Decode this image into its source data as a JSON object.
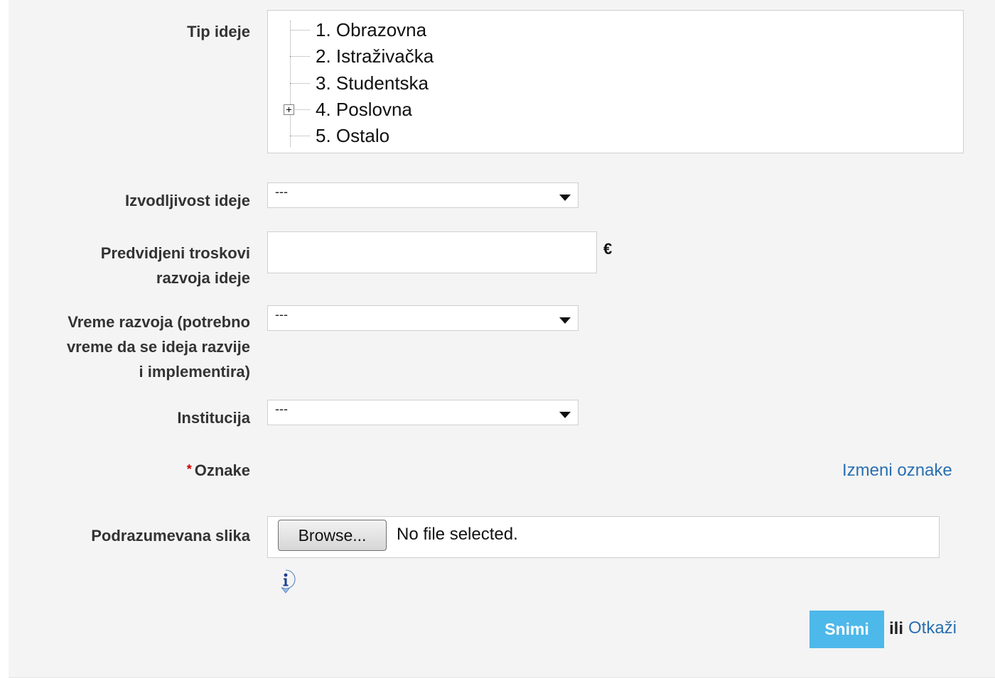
{
  "form": {
    "idea_type": {
      "label": "Tip ideje",
      "items": [
        {
          "label": "1. Obrazovna",
          "expandable": false
        },
        {
          "label": "2. Istraživačka",
          "expandable": false
        },
        {
          "label": "3. Studentska",
          "expandable": false
        },
        {
          "label": "4. Poslovna",
          "expandable": true
        },
        {
          "label": "5. Ostalo",
          "expandable": false
        }
      ]
    },
    "feasibility": {
      "label": "Izvodljivost ideje",
      "value": "---"
    },
    "estimated_costs": {
      "label_line1": "Predvidjeni troskovi",
      "label_line2": "razvoja ideje",
      "value": "",
      "unit": "€"
    },
    "development_time": {
      "label_line1": "Vreme razvoja (potrebno",
      "label_line2": "vreme da se ideja razvije",
      "label_line3": "i implementira)",
      "value": "---"
    },
    "institution": {
      "label": "Institucija",
      "value": "---"
    },
    "tags": {
      "required_marker": "*",
      "label": "Oznake",
      "edit_link": "Izmeni oznake"
    },
    "default_image": {
      "label": "Podrazumevana slika",
      "browse_label": "Browse...",
      "status": "No file selected."
    },
    "actions": {
      "save_label": "Snimi",
      "or_text": "ili",
      "cancel_label": "Otkaži"
    }
  },
  "colors": {
    "accent": "#4db8ea",
    "link": "#2a6fb0",
    "required": "#cc0000",
    "panel_bg": "#f4f4f4"
  },
  "icons": {
    "info": "info-icon",
    "tree_expander": "plus-box-icon",
    "dropdown": "chevron-down-icon"
  }
}
